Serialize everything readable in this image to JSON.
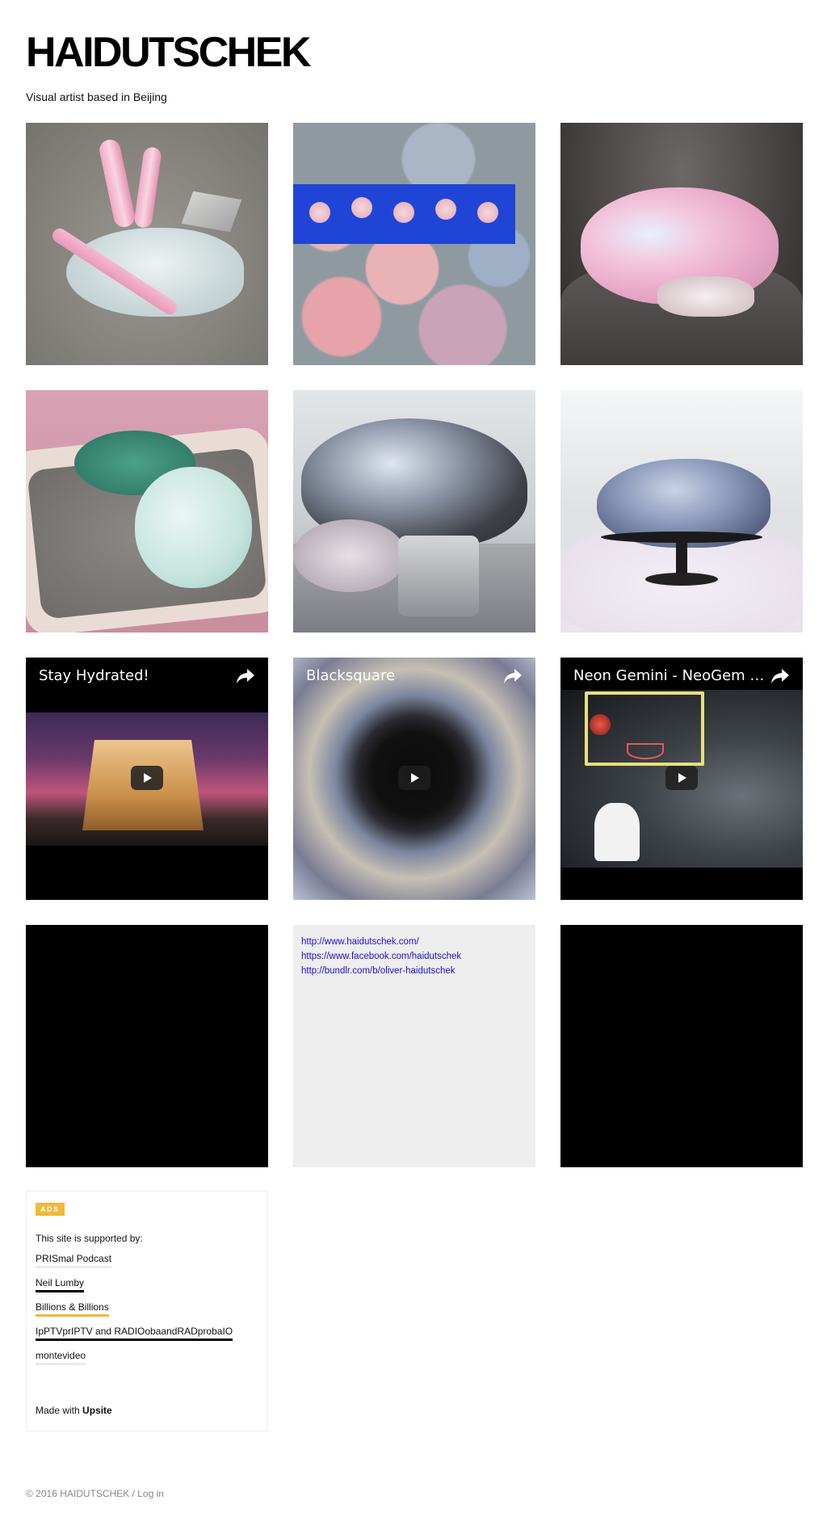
{
  "site": {
    "title": "HAIDUTSCHEK",
    "subtitle": "Visual artist based in Beijing"
  },
  "videos": [
    {
      "title": "Stay Hydrated!",
      "icon": "share-icon"
    },
    {
      "title": "Blacksquare",
      "icon": "share-icon"
    },
    {
      "title": "Neon Gemini - NeoGem α - …",
      "icon": "share-icon"
    }
  ],
  "links": [
    "http://www.haidutschek.com/",
    "https://www.facebook.com/haidutschek",
    "http://bundlr.com/b/oliver-haidutschek"
  ],
  "ads": {
    "badge": "ADS",
    "intro": "This site is supported by:",
    "sponsors": [
      "PRISmal Podcast",
      "Neil Lumby",
      "Billions & Billions",
      "IpPTVprIPTV and RADIOobaandRADprobaIO",
      "montevideo"
    ],
    "made_with_prefix": "Made with ",
    "made_with_brand": "Upsite"
  },
  "footer": {
    "copyright": "© 2016 HAIDUTSCHEK / ",
    "login": "Log in"
  },
  "colors": {
    "ads_badge": "#f0b939",
    "link": "#1a10d6",
    "links_tile_bg": "#eeeeee"
  }
}
